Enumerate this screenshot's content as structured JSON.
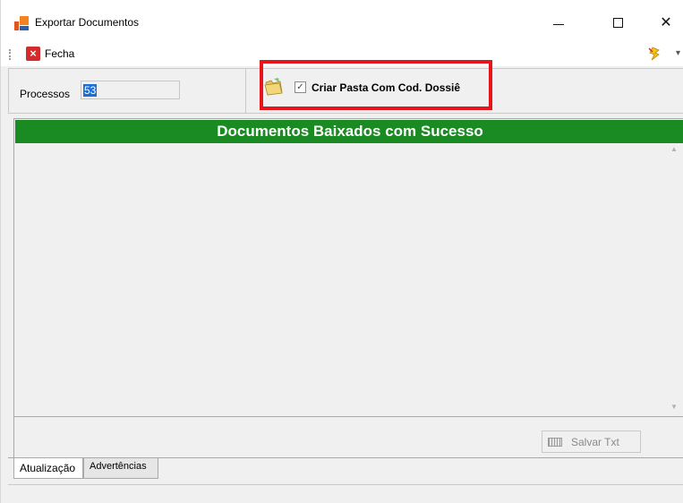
{
  "window": {
    "title": "Exportar Documentos",
    "minimize_glyph": "",
    "maximize_glyph": "",
    "close_glyph": "✕"
  },
  "toolbar": {
    "fecha_label": "Fecha",
    "fecha_icon": "close-icon",
    "bolt_icon": "lightning-icon"
  },
  "filter": {
    "processos_label": "Processos",
    "processos_value": "53",
    "criar_pasta_label": "Criar Pasta Com Cod. Dossiê",
    "criar_pasta_checked": true,
    "checkbox_glyph": "✓"
  },
  "grid": {
    "header": "Documentos Baixados com Sucesso",
    "header_color": "#1a8a22",
    "rows": []
  },
  "actions": {
    "salvar_label": "Salvar Txt"
  },
  "tabs": [
    {
      "label": "Atualização",
      "active": true
    },
    {
      "label": "Advertências",
      "active": false
    }
  ],
  "colors": {
    "highlight": "#e8141c",
    "selection": "#1c6fd6"
  }
}
